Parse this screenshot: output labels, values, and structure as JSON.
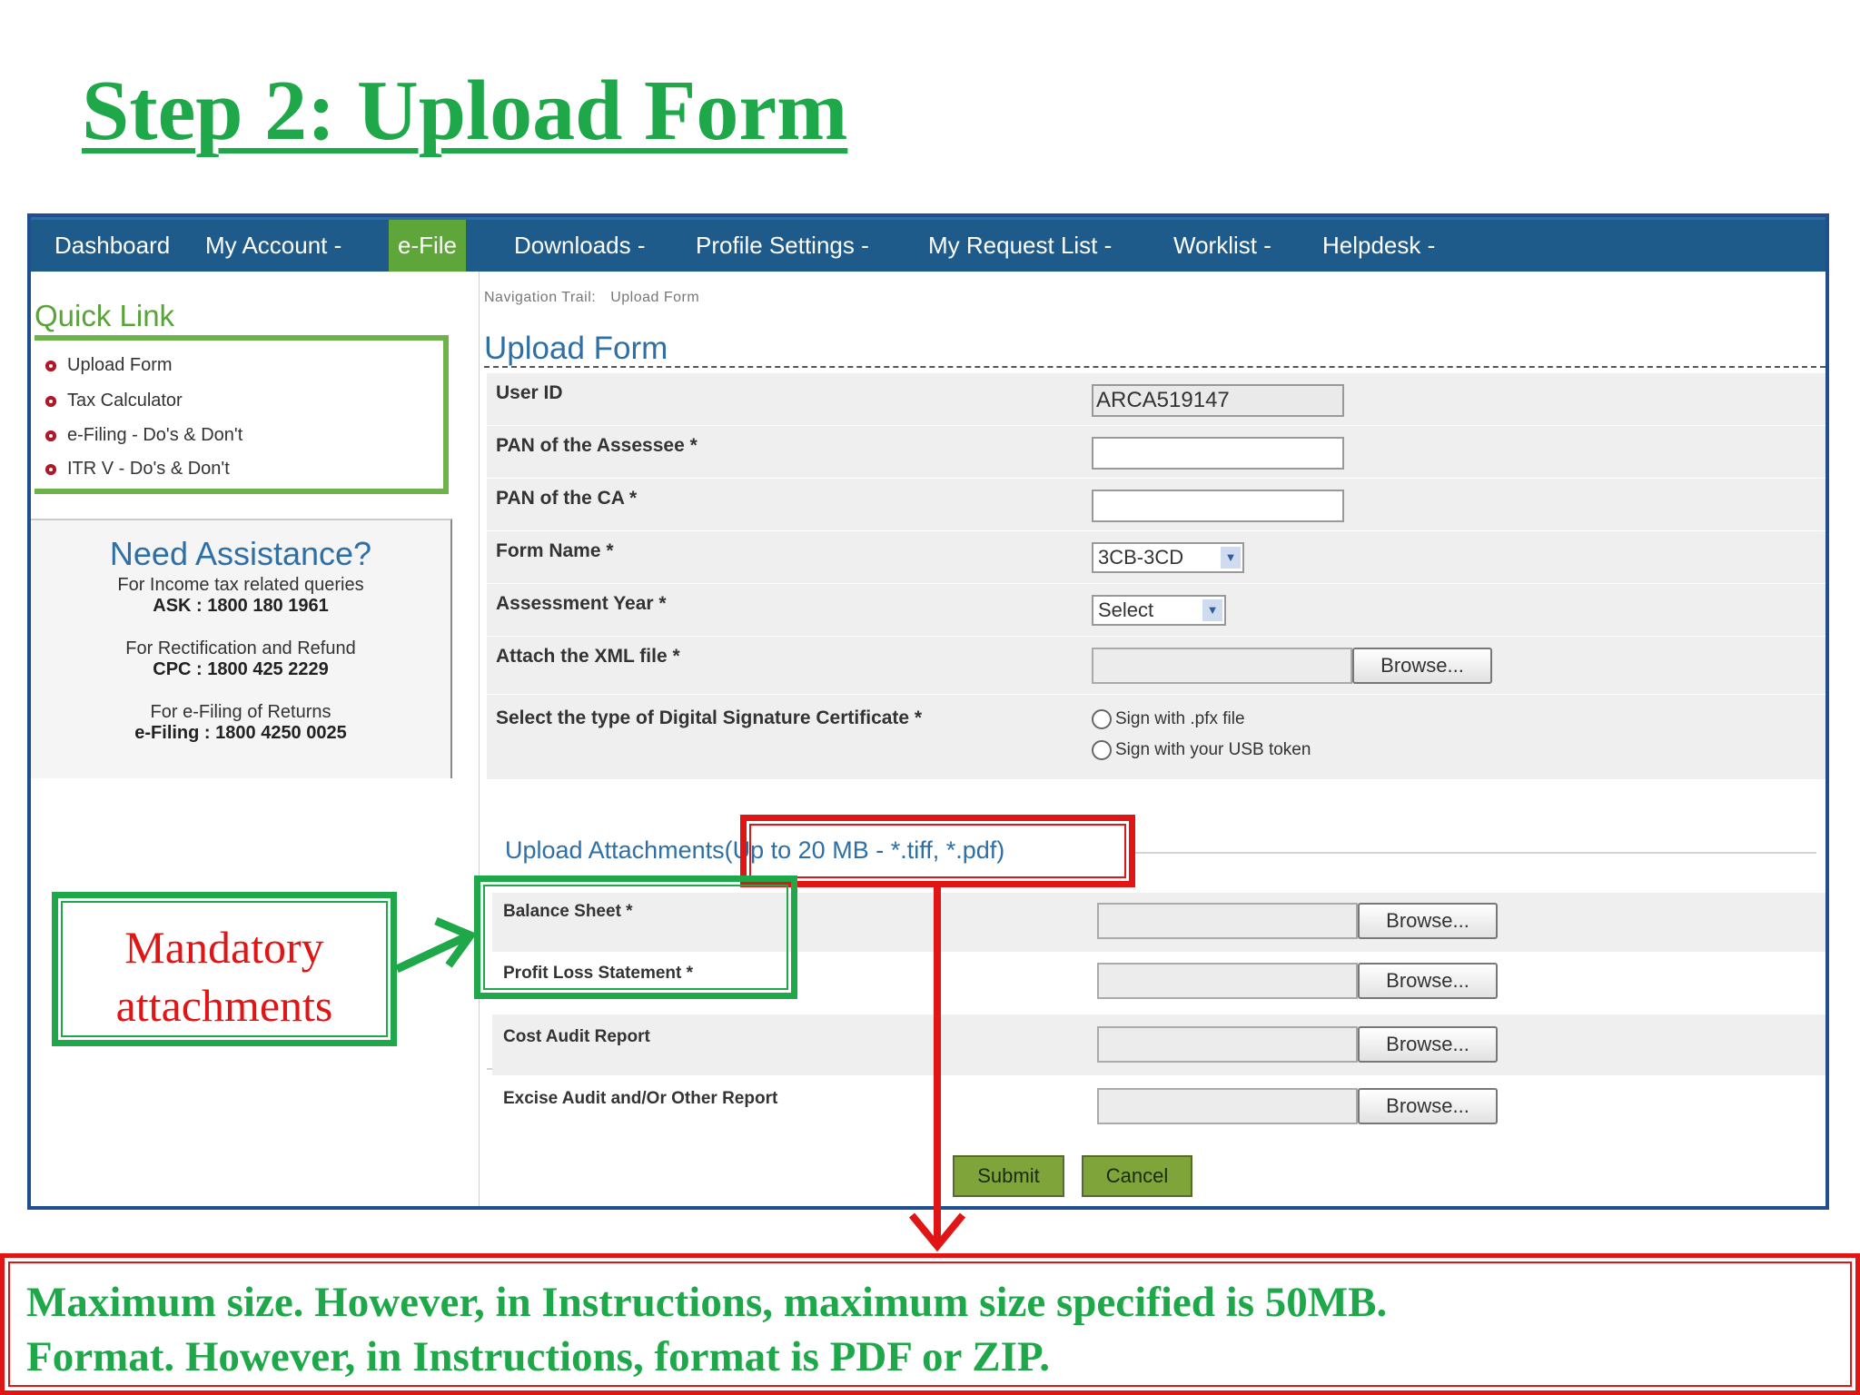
{
  "slide": {
    "title": "Step 2: Upload Form"
  },
  "nav": {
    "items": [
      "Dashboard",
      "My Account -",
      "e-File",
      "Downloads -",
      "Profile Settings -",
      "My Request List -",
      "Worklist -",
      "Helpdesk -"
    ]
  },
  "sidebar": {
    "quick_link_title": "Quick Link",
    "quick_links": [
      "Upload Form",
      "Tax Calculator",
      "e-Filing - Do's & Don't",
      "ITR V - Do's & Don't"
    ],
    "assistance": {
      "title": "Need Assistance?",
      "entries": [
        {
          "label": "For Income tax related queries",
          "number": "ASK : 1800 180 1961"
        },
        {
          "label": "For Rectification and Refund",
          "number": "CPC : 1800 425 2229"
        },
        {
          "label": "For e-Filing of Returns",
          "number": "e-Filing : 1800 4250 0025"
        }
      ]
    }
  },
  "main": {
    "trail_label": "Navigation Trail:",
    "trail_value": "Upload Form",
    "form_title": "Upload Form",
    "fields": {
      "user_id": {
        "label": "User ID",
        "value": "ARCA519147"
      },
      "pan_assessee": {
        "label": "PAN of the Assessee *",
        "value": ""
      },
      "pan_ca": {
        "label": "PAN of the CA *",
        "value": ""
      },
      "form_name": {
        "label": "Form Name *",
        "value": "3CB-3CD"
      },
      "assessment_year": {
        "label": "Assessment Year *",
        "value": "Select"
      },
      "xml_file": {
        "label": "Attach the XML file *",
        "button": "Browse..."
      },
      "dsc": {
        "label": "Select the type of Digital Signature Certificate *",
        "options": [
          "Sign with .pfx file",
          "Sign with your USB token"
        ]
      }
    },
    "attachments": {
      "legend": "Upload Attachments(Up to 20 MB - *.tiff, *.pdf)",
      "rows": [
        {
          "label": "Balance Sheet *",
          "button": "Browse..."
        },
        {
          "label": "Profit Loss Statement *",
          "button": "Browse..."
        },
        {
          "label": "Cost Audit Report",
          "button": "Browse..."
        },
        {
          "label": "Excise Audit and/Or Other Report",
          "button": "Browse..."
        }
      ]
    },
    "buttons": {
      "submit": "Submit",
      "cancel": "Cancel"
    }
  },
  "annotations": {
    "mandatory": "Mandatory attachments",
    "note_lines": [
      "Maximum size. However, in Instructions, maximum size specified is 50MB.",
      "Format. However, in Instructions, format is PDF or ZIP."
    ]
  },
  "colors": {
    "accent_green": "#1ea84a",
    "annotation_red": "#e01515",
    "nav_blue": "#1e5a8a",
    "link_blue": "#2d6fa6"
  }
}
